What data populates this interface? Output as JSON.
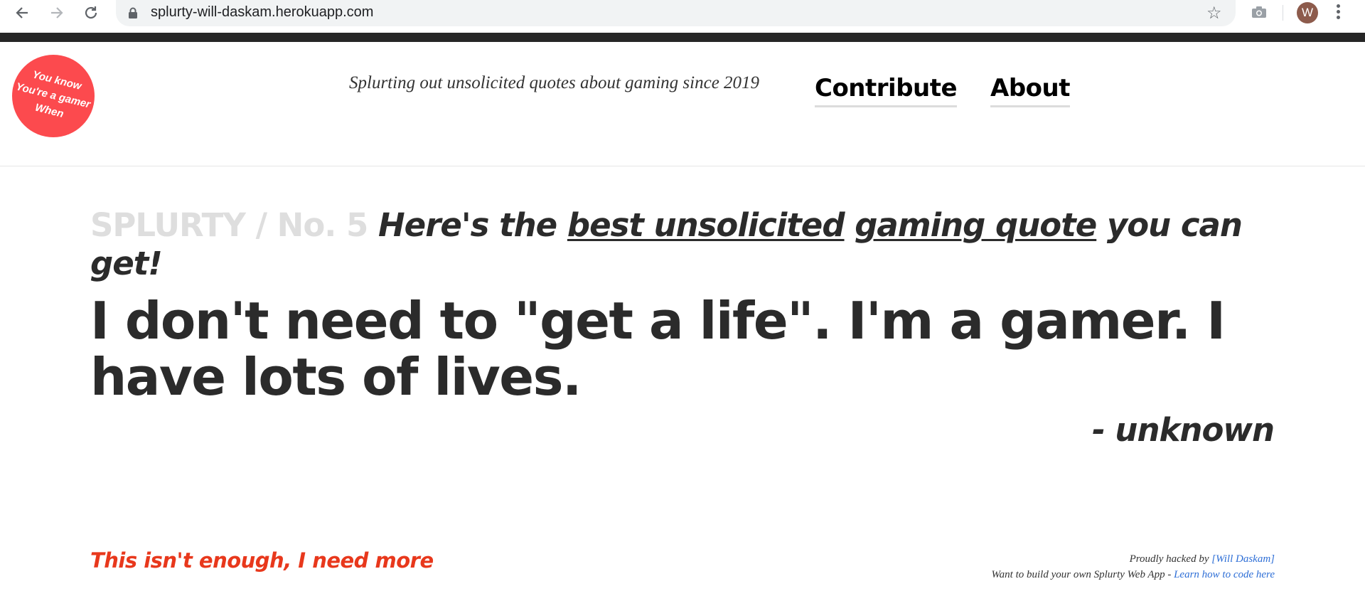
{
  "browser": {
    "url": "splurty-will-daskam.herokuapp.com",
    "avatar_letter": "W",
    "icons": [
      "back-arrow-icon",
      "forward-arrow-icon",
      "reload-icon",
      "lock-icon",
      "star-icon",
      "camera-icon",
      "kebab-menu-icon"
    ]
  },
  "header": {
    "logo_text": "You know\nYou're a gamer\nWhen",
    "tagline": "Splurting out unsolicited quotes about gaming since 2019",
    "nav": {
      "contribute": "Contribute",
      "about": "About"
    }
  },
  "main": {
    "brand": "SPLURTY / No. 5",
    "lead_before": "Here's the ",
    "lead_emph_1": "best unsolicited",
    "lead_emph_2": "gaming quote",
    "lead_after": " you can get!",
    "quote": "I don't need to \"get a life\". I'm a gamer. I have lots of lives.",
    "attribution": "- unknown"
  },
  "footer": {
    "more_link": "This isn't enough, I need more",
    "credit_prefix": "Proudly hacked by ",
    "credit_author": "[Will Daskam]",
    "build_prefix": "Want to build your own Splurty Web App - ",
    "build_link": "Learn how to code here"
  },
  "colors": {
    "logo_badge": "#fc4a4e",
    "brand_gray": "#dedede",
    "text_dark": "#2b2b2b",
    "more_link": "#e8381c",
    "link_blue": "#2d6ed6",
    "top_bar": "#262626"
  }
}
